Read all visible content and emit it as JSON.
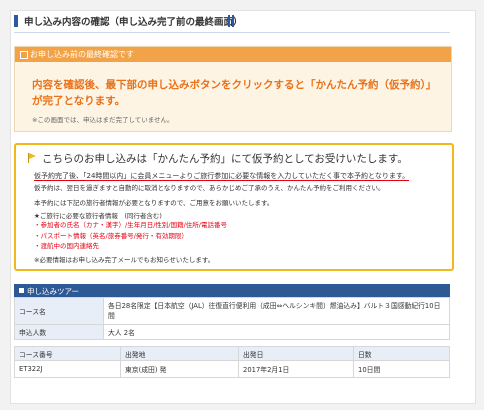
{
  "header": {
    "title": "申し込み内容の確認（申し込み完了前の最終画面）"
  },
  "notice": {
    "heading": "お申し込み前の最終確認です",
    "main": "内容を確認後、最下部の申し込みボタンをクリックすると「かんたん予約（仮予約）」が完了となります。",
    "sub": "※この画面では、申込はまだ完了していません。"
  },
  "booking_box": {
    "title": "こちらのお申し込みは「かんたん予約」にて仮予約としてお受けいたします。",
    "line1_underlined": "仮予約完了後、「24時間以内」に会員メニューよりご旅行参加に必要な情報を入力していただく事で本予約となります。",
    "line2": "仮予約は、翌日を過ぎますと自動的に取消となりますので、あらかじめご了承のうえ、かんたん予約をご利用ください。",
    "line3": "本予約には下記の旅行者情報が必要となりますので、ご用意をお願いいたします。",
    "line4": "★ご旅行に必要な旅行者情報　(同行者含む)",
    "items": [
      "・参加者の氏名（カナ・漢字）/生年月日/性別/国籍/住所/電話番号",
      "・パスポート情報（英名/旅券番号/発行・有効期限）",
      "・渡航中の国内連絡先"
    ],
    "line5": "※必要情報はお申し込み完了メールでもお知らせいたします。"
  },
  "tour": {
    "heading": "申し込みツアー",
    "course_label": "コース名",
    "course_value": "各日28名限定【日本航空（JAL）往復直行便利用（成田⇔ヘルシンキ間）燃油込み】バルト３国感動紀行10日間",
    "people_label": "申込人数",
    "people_value": "大人 2名",
    "columns": [
      "コース番号",
      "出発地",
      "出発日",
      "日数"
    ],
    "row": [
      "ET322J",
      "東京(成田) 発",
      "2017年2月1日",
      "10日間"
    ]
  }
}
